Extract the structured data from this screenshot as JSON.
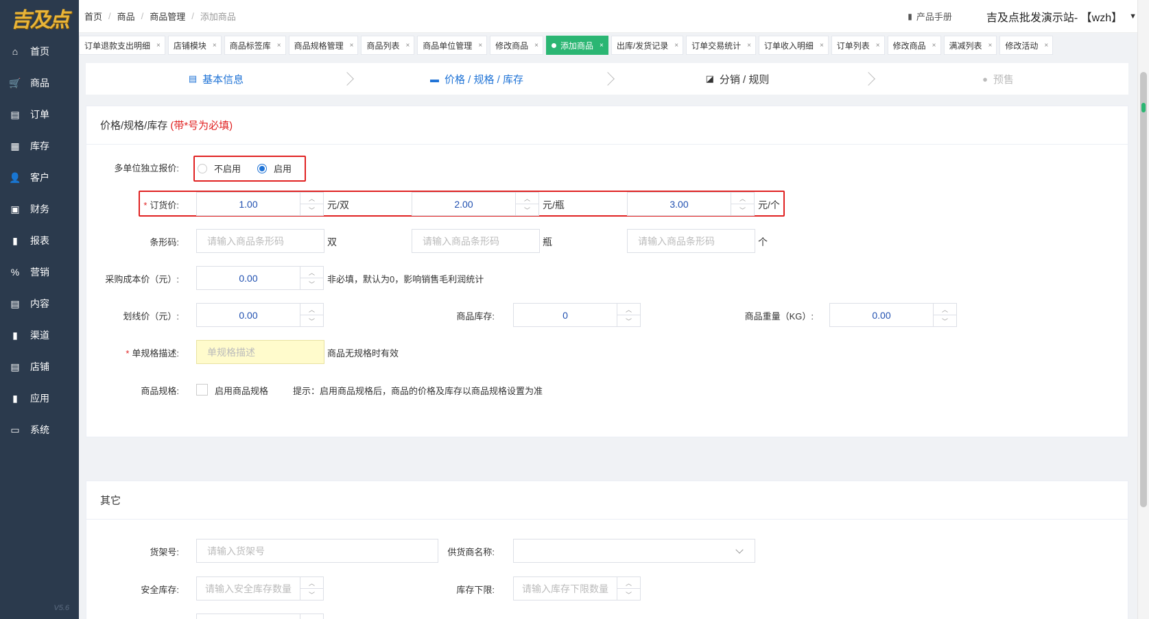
{
  "logo": {
    "text": "吉及点"
  },
  "version": "V5.6",
  "sidebar": {
    "items": [
      {
        "label": "首页",
        "icon": "home-icon",
        "glyph": "⌂"
      },
      {
        "label": "商品",
        "icon": "cart-icon",
        "glyph": "🛒"
      },
      {
        "label": "订单",
        "icon": "order-icon",
        "glyph": "▤"
      },
      {
        "label": "库存",
        "icon": "grid-icon",
        "glyph": "▦"
      },
      {
        "label": "客户",
        "icon": "user-icon",
        "glyph": "👤"
      },
      {
        "label": "财务",
        "icon": "wallet-icon",
        "glyph": "▣"
      },
      {
        "label": "报表",
        "icon": "bar-chart-icon",
        "glyph": "▮"
      },
      {
        "label": "营销",
        "icon": "percent-icon",
        "glyph": "%"
      },
      {
        "label": "内容",
        "icon": "document-icon",
        "glyph": "▤"
      },
      {
        "label": "渠道",
        "icon": "bar-chart-icon",
        "glyph": "▮"
      },
      {
        "label": "店铺",
        "icon": "store-icon",
        "glyph": "▤"
      },
      {
        "label": "应用",
        "icon": "bar-chart-icon",
        "glyph": "▮"
      },
      {
        "label": "系统",
        "icon": "monitor-icon",
        "glyph": "▭"
      }
    ]
  },
  "breadcrumb": {
    "items": [
      "首页",
      "商品",
      "商品管理",
      "添加商品"
    ]
  },
  "header": {
    "manual": "产品手册",
    "site": "吉及点批发演示站- 【wzh】"
  },
  "tabs": [
    {
      "label": "订单退款支出明细",
      "active": false
    },
    {
      "label": "店铺模块",
      "active": false
    },
    {
      "label": "商品标签库",
      "active": false
    },
    {
      "label": "商品规格管理",
      "active": false
    },
    {
      "label": "商品列表",
      "active": false
    },
    {
      "label": "商品单位管理",
      "active": false
    },
    {
      "label": "修改商品",
      "active": false
    },
    {
      "label": "添加商品",
      "active": true
    },
    {
      "label": "出库/发货记录",
      "active": false
    },
    {
      "label": "订单交易统计",
      "active": false
    },
    {
      "label": "订单收入明细",
      "active": false
    },
    {
      "label": "订单列表",
      "active": false
    },
    {
      "label": "修改商品",
      "active": false
    },
    {
      "label": "满减列表",
      "active": false
    },
    {
      "label": "修改活动",
      "active": false
    }
  ],
  "steps": [
    {
      "label": "基本信息",
      "icon": "clipboard-icon",
      "state": "blue"
    },
    {
      "label": "价格 / 规格 / 库存",
      "icon": "box-icon",
      "state": "blue"
    },
    {
      "label": "分销 / 规则",
      "icon": "line-chart-icon",
      "state": "dark"
    },
    {
      "label": "预售",
      "icon": "circle-icon",
      "state": "gray"
    }
  ],
  "price_card": {
    "title": "价格/规格/库存",
    "title_note": "(带*号为必填)",
    "multi_unit": {
      "label": "多单位独立报价:",
      "options": [
        "不启用",
        "启用"
      ],
      "selected": "启用"
    },
    "order_price": {
      "label": "订货价:",
      "values": [
        "1.00",
        "2.00",
        "3.00"
      ],
      "units": [
        "元/双",
        "元/瓶",
        "元/个"
      ]
    },
    "barcode": {
      "label": "条形码:",
      "placeholder": "请输入商品条形码",
      "units": [
        "双",
        "瓶",
        "个"
      ]
    },
    "cost": {
      "label": "采购成本价（元）:",
      "value": "0.00",
      "hint": "非必填，默认为0，影响销售毛利润统计"
    },
    "strike_price": {
      "label": "划线价（元）:",
      "value": "0.00"
    },
    "stock": {
      "label": "商品库存:",
      "value": "0"
    },
    "weight": {
      "label": "商品重量（KG）:",
      "value": "0.00"
    },
    "spec_desc": {
      "label": "单规格描述:",
      "placeholder": "单规格描述",
      "hint": "商品无规格时有效"
    },
    "spec": {
      "label": "商品规格:",
      "checkbox": "启用商品规格",
      "hint": "提示：启用商品规格后，商品的价格及库存以商品规格设置为准"
    }
  },
  "other_card": {
    "title": "其它",
    "shelf": {
      "label": "货架号:",
      "placeholder": "请输入货架号"
    },
    "supplier": {
      "label": "供货商名称:"
    },
    "safety_stock": {
      "label": "安全库存:",
      "placeholder": "请输入安全库存数量"
    },
    "stock_min": {
      "label": "库存下限:",
      "placeholder": "请输入库存下限数量"
    }
  }
}
